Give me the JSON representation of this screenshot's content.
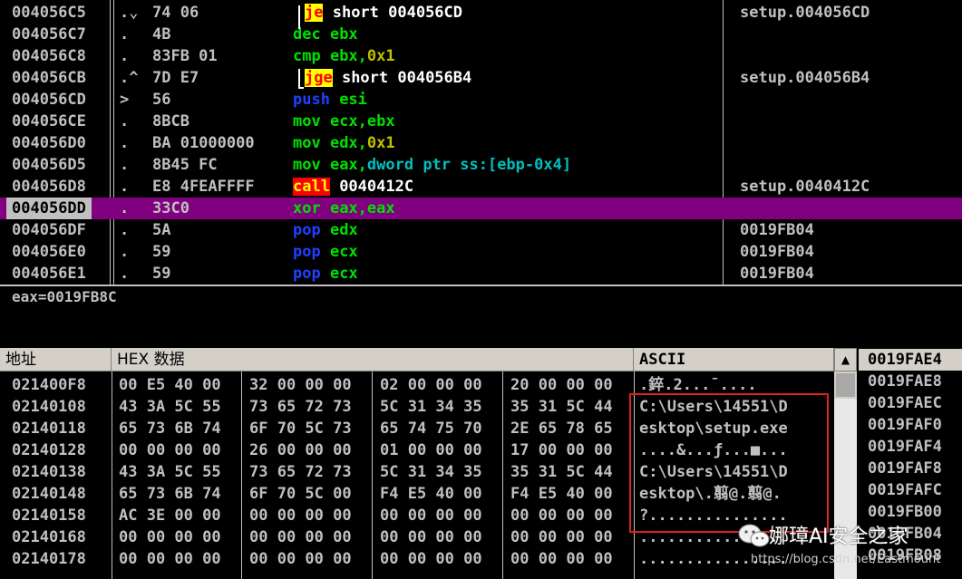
{
  "disasm": {
    "rows": [
      {
        "addr": "004056C5",
        "mark": ".⌄",
        "hex": "74 06",
        "parts": [
          {
            "t": "je",
            "c": "t-hlyel"
          },
          {
            "t": " short 004056CD",
            "c": "t-white"
          }
        ],
        "comment": "setup.004056CD"
      },
      {
        "addr": "004056C7",
        "mark": ".",
        "hex": "4B",
        "parts": [
          {
            "t": "dec",
            "c": "t-green"
          },
          {
            "t": " ebx",
            "c": "t-green"
          }
        ],
        "comment": ""
      },
      {
        "addr": "004056C8",
        "mark": ".",
        "hex": "83FB 01",
        "parts": [
          {
            "t": "cmp",
            "c": "t-green"
          },
          {
            "t": " ebx,",
            "c": "t-green"
          },
          {
            "t": "0x1",
            "c": "t-olive"
          }
        ],
        "comment": ""
      },
      {
        "addr": "004056CB",
        "mark": ".^",
        "hex": "7D E7",
        "parts": [
          {
            "t": "jge",
            "c": "t-hlyel"
          },
          {
            "t": " short 004056B4",
            "c": "t-white"
          }
        ],
        "comment": "setup.004056B4"
      },
      {
        "addr": "004056CD",
        "mark": ">",
        "hex": "56",
        "parts": [
          {
            "t": "push",
            "c": "t-blue"
          },
          {
            "t": " esi",
            "c": "t-green"
          }
        ],
        "comment": ""
      },
      {
        "addr": "004056CE",
        "mark": ".",
        "hex": "8BCB",
        "parts": [
          {
            "t": "mov",
            "c": "t-green"
          },
          {
            "t": " ecx,ebx",
            "c": "t-green"
          }
        ],
        "comment": ""
      },
      {
        "addr": "004056D0",
        "mark": ".",
        "hex": "BA 01000000",
        "parts": [
          {
            "t": "mov",
            "c": "t-green"
          },
          {
            "t": " edx,",
            "c": "t-green"
          },
          {
            "t": "0x1",
            "c": "t-olive"
          }
        ],
        "comment": ""
      },
      {
        "addr": "004056D5",
        "mark": ".",
        "hex": "8B45 FC",
        "parts": [
          {
            "t": "mov",
            "c": "t-green"
          },
          {
            "t": " eax,",
            "c": "t-green"
          },
          {
            "t": "dword ptr ss:[ebp-0x4]",
            "c": "t-cyan"
          }
        ],
        "comment": ""
      },
      {
        "addr": "004056D8",
        "mark": ".",
        "hex": "E8 4FEAFFFF",
        "parts": [
          {
            "t": "call",
            "c": "t-hlred"
          },
          {
            "t": " 0040412C",
            "c": "t-white"
          }
        ],
        "comment": "setup.0040412C"
      },
      {
        "addr": "004056DD",
        "mark": ".",
        "hex": "33C0",
        "parts": [
          {
            "t": "xor",
            "c": "t-green"
          },
          {
            "t": " eax,eax",
            "c": "t-green"
          }
        ],
        "comment": "",
        "selected": true
      },
      {
        "addr": "004056DF",
        "mark": ".",
        "hex": "5A",
        "parts": [
          {
            "t": "pop",
            "c": "t-blue"
          },
          {
            "t": " edx",
            "c": "t-green"
          }
        ],
        "comment": "0019FB04"
      },
      {
        "addr": "004056E0",
        "mark": ".",
        "hex": "59",
        "parts": [
          {
            "t": "pop",
            "c": "t-blue"
          },
          {
            "t": " ecx",
            "c": "t-green"
          }
        ],
        "comment": "0019FB04"
      },
      {
        "addr": "004056E1",
        "mark": ".",
        "hex": "59",
        "parts": [
          {
            "t": "pop",
            "c": "t-blue"
          },
          {
            "t": " ecx",
            "c": "t-green"
          }
        ],
        "comment": "0019FB04"
      }
    ]
  },
  "info": {
    "text": "eax=0019FB8C"
  },
  "dump": {
    "headers": {
      "address": "地址",
      "hex": "HEX 数据",
      "ascii": "ASCII"
    },
    "rows": [
      {
        "addr": "021400F8",
        "hex": [
          "00 E5 40 00",
          "32 00 00 00",
          "02 00 00 00",
          "20 00 00 00"
        ],
        "ascii": ".錊.2...ˉ...."
      },
      {
        "addr": "02140108",
        "hex": [
          "43 3A 5C 55",
          "73 65 72 73",
          "5C 31 34 35",
          "35 31 5C 44"
        ],
        "ascii": "C:\\Users\\14551\\D"
      },
      {
        "addr": "02140118",
        "hex": [
          "65 73 6B 74",
          "6F 70 5C 73",
          "65 74 75 70",
          "2E 65 78 65"
        ],
        "ascii": "esktop\\setup.exe"
      },
      {
        "addr": "02140128",
        "hex": [
          "00 00 00 00",
          "26 00 00 00",
          "01 00 00 00",
          "17 00 00 00"
        ],
        "ascii": "....&...ƒ...■..."
      },
      {
        "addr": "02140138",
        "hex": [
          "43 3A 5C 55",
          "73 65 72 73",
          "5C 31 34 35",
          "35 31 5C 44"
        ],
        "ascii": "C:\\Users\\14551\\D"
      },
      {
        "addr": "02140148",
        "hex": [
          "65 73 6B 74",
          "6F 70 5C 00",
          "F4 E5 40 00",
          "F4 E5 40 00"
        ],
        "ascii": "esktop\\.翦@.翦@."
      },
      {
        "addr": "02140158",
        "hex": [
          "AC 3E 00 00",
          "00 00 00 00",
          "00 00 00 00",
          "00 00 00 00"
        ],
        "ascii": "?..............."
      },
      {
        "addr": "02140168",
        "hex": [
          "00 00 00 00",
          "00 00 00 00",
          "00 00 00 00",
          "00 00 00 00"
        ],
        "ascii": "................"
      },
      {
        "addr": "02140178",
        "hex": [
          "00 00 00 00",
          "00 00 00 00",
          "00 00 00 00",
          "00 00 00 00"
        ],
        "ascii": "................"
      }
    ]
  },
  "stack": {
    "rows": [
      "0019FAE4",
      "0019FAE8",
      "0019FAEC",
      "0019FAF0",
      "0019FAF4",
      "0019FAF8",
      "0019FAFC",
      "0019FB00",
      "0019FB04",
      "0019FB08"
    ]
  },
  "watermark": {
    "title": "娜璋AI安全之家",
    "url": "https://blog.csdn.net/Eastmount"
  },
  "colors": {
    "selection": "#800080",
    "annotation": "#e02020"
  }
}
